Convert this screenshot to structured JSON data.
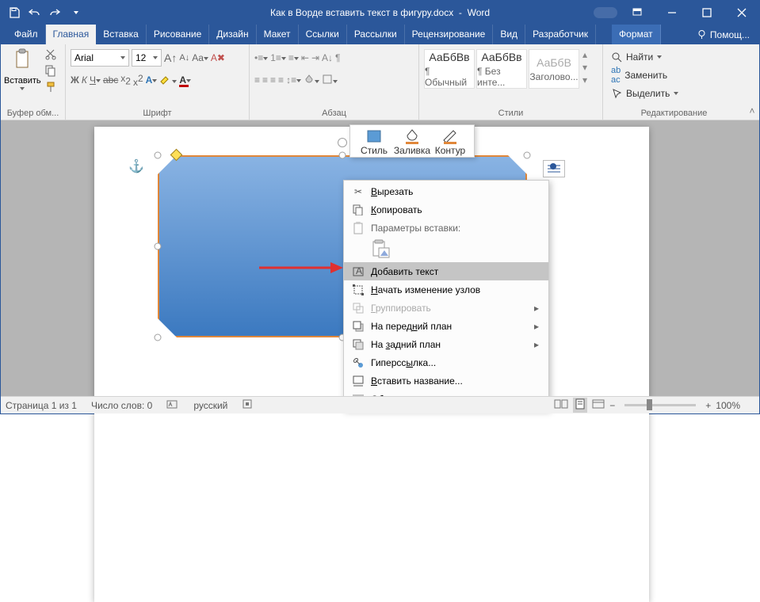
{
  "title": {
    "doc": "Как в Ворде вставить текст в фигуру.docx",
    "sep": "-",
    "app": "Word"
  },
  "tabs": {
    "file": "Файл",
    "home": "Главная",
    "insert": "Вставка",
    "draw": "Рисование",
    "design": "Дизайн",
    "layout": "Макет",
    "refs": "Ссылки",
    "mail": "Рассылки",
    "review": "Рецензирование",
    "view": "Вид",
    "developer": "Разработчик",
    "format": "Формат",
    "tellme": "Помощ..."
  },
  "ribbon": {
    "clipboard": {
      "paste": "Вставить",
      "label": "Буфер обм..."
    },
    "font": {
      "name": "Arial",
      "size": "12",
      "label": "Шрифт"
    },
    "paragraph": {
      "label": "Абзац"
    },
    "styles": {
      "s1prev": "АаБбВв",
      "s1": "¶ Обычный",
      "s2prev": "АаБбВв",
      "s2": "¶ Без инте...",
      "s3prev": "АаБбВ",
      "s3": "Заголово...",
      "label": "Стили"
    },
    "editing": {
      "find": "Найти",
      "replace": "Заменить",
      "select": "Выделить",
      "label": "Редактирование"
    }
  },
  "minitoolbar": {
    "style": "Стиль",
    "fill": "Заливка",
    "outline": "Контур"
  },
  "context": {
    "cut": "Вырезать",
    "copy": "Копировать",
    "pasteopts": "Параметры вставки:",
    "addtext": "Добавить текст",
    "editpoints": "Начать изменение узлов",
    "group": "Группировать",
    "bringfront": "На передний план",
    "sendback": "На задний план",
    "hyperlink": "Гиперссылка...",
    "caption": "Вставить название...",
    "wrap": "Обтекание текстом"
  },
  "status": {
    "page": "Страница 1 из 1",
    "words": "Число слов: 0",
    "lang": "русский",
    "zoom": "100%"
  }
}
